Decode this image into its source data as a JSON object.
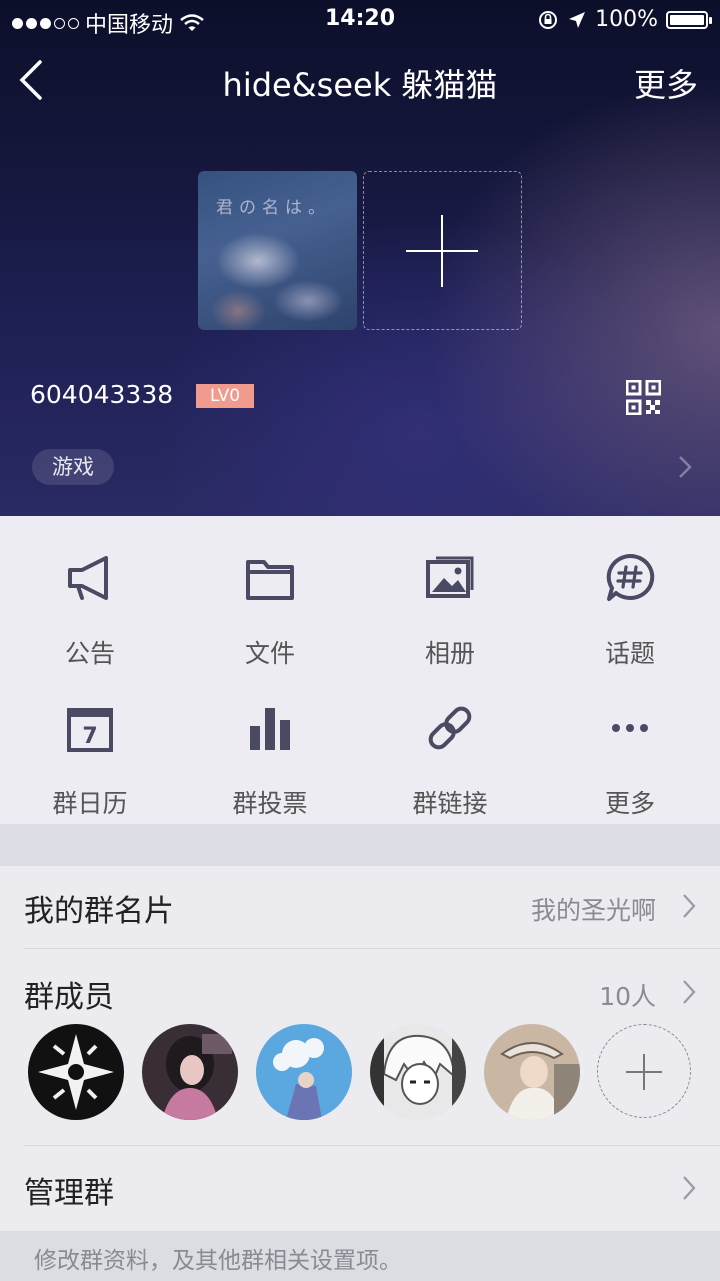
{
  "status_bar": {
    "carrier": "中国移动",
    "time": "14:20",
    "battery_text": "100%",
    "battery_level": 1.0
  },
  "nav": {
    "title": "hide&seek 躲猫猫",
    "more_label": "更多",
    "back_icon": "chevron-left-icon"
  },
  "hero": {
    "photo_caption": "君の名は。",
    "group_number": "604043338",
    "level_badge": "LV0",
    "tag": "游戏",
    "qr_icon": "qr-code-icon"
  },
  "grid": {
    "items": [
      {
        "label": "公告",
        "icon": "megaphone-icon"
      },
      {
        "label": "文件",
        "icon": "folder-icon"
      },
      {
        "label": "相册",
        "icon": "photo-album-icon"
      },
      {
        "label": "话题",
        "icon": "hashtag-chat-icon"
      },
      {
        "label": "群日历",
        "icon": "calendar-icon"
      },
      {
        "label": "群投票",
        "icon": "bar-chart-icon"
      },
      {
        "label": "群链接",
        "icon": "link-icon"
      },
      {
        "label": "更多",
        "icon": "more-dots-icon"
      }
    ],
    "calendar_day": "7"
  },
  "list": {
    "card_label": "我的群名片",
    "card_value": "我的圣光啊",
    "members_label": "群成员",
    "members_count": "10人",
    "manage_label": "管理群"
  },
  "footer": {
    "note": "修改群资料，及其他群相关设置项。"
  },
  "colors": {
    "accent_badge": "#f19a8e",
    "hero_top": "#0c0f2a",
    "icon_color": "#4a4a62"
  }
}
